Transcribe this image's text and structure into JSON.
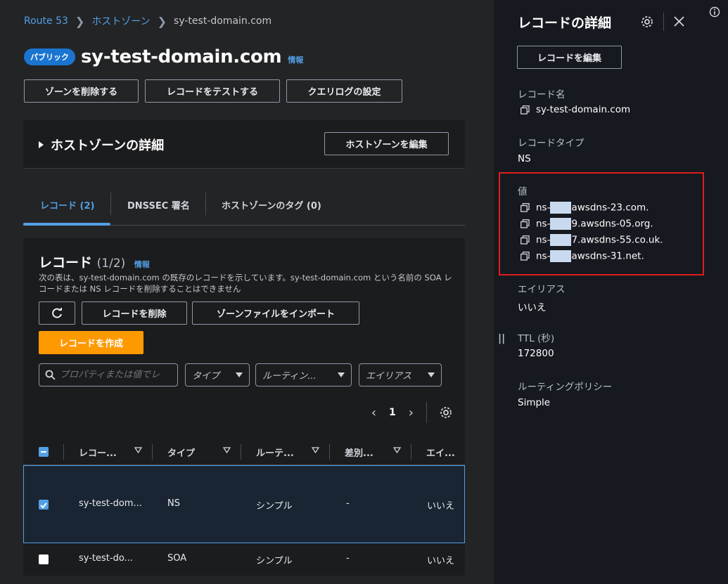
{
  "breadcrumb": {
    "items": [
      "Route 53",
      "ホストゾーン",
      "sy-test-domain.com"
    ]
  },
  "header": {
    "badge": "パブリック",
    "title": "sy-test-domain.com",
    "info": "情報"
  },
  "actions": {
    "delete_zone": "ゾーンを削除する",
    "test_record": "レコードをテストする",
    "query_log": "クエリログの設定"
  },
  "hosted_zone_panel": {
    "title": "ホストゾーンの詳細",
    "edit_button": "ホストゾーンを編集"
  },
  "tabs": [
    {
      "label": "レコード (2)"
    },
    {
      "label": "DNSSEC 署名"
    },
    {
      "label": "ホストゾーンのタグ (0)"
    }
  ],
  "records": {
    "title": "レコード",
    "count": "(1/2)",
    "info": "情報",
    "description": "次の表は、sy-test-domain.com の既存のレコードを示しています。sy-test-domain.com という名前の SOA レコードまたは NS レコードを削除することはできません",
    "delete_button": "レコードを削除",
    "import_button": "ゾーンファイルをインポート",
    "create_button": "レコードを作成",
    "search_placeholder": "プロパティまたは値でレ",
    "filters": [
      "タイプ",
      "ルーティン...",
      "エイリアス"
    ],
    "page": "1",
    "columns": [
      "レコー...",
      "タイプ",
      "ルーテ...",
      "差別...",
      "エイ..."
    ],
    "rows": [
      {
        "name": "sy-test-dom...",
        "type": "NS",
        "routing": "シンプル",
        "diff": "-",
        "alias": "いいえ",
        "selected": true
      },
      {
        "name": "sy-test-do...",
        "type": "SOA",
        "routing": "シンプル",
        "diff": "-",
        "alias": "いいえ",
        "selected": false
      }
    ]
  },
  "sidebar": {
    "title": "レコードの詳細",
    "edit_button": "レコードを編集",
    "record_name_label": "レコード名",
    "record_name": "sy-test-domain.com",
    "record_type_label": "レコードタイプ",
    "record_type": "NS",
    "value_label": "値",
    "ns_values": [
      {
        "prefix": "ns-",
        "suffix": "awsdns-23.com."
      },
      {
        "prefix": "ns-",
        "suffix": "9.awsdns-05.org."
      },
      {
        "prefix": "ns-",
        "suffix": "7.awsdns-55.co.uk."
      },
      {
        "prefix": "ns-",
        "suffix": "awsdns-31.net."
      }
    ],
    "alias_label": "エイリアス",
    "alias": "いいえ",
    "ttl_label": "TTL (秒)",
    "ttl": "172800",
    "routing_label": "ルーティングポリシー",
    "routing": "Simple"
  },
  "colors": {
    "accent": "#539fe5",
    "primary_button": "#ff9900",
    "highlight_box": "#e11d1d"
  }
}
